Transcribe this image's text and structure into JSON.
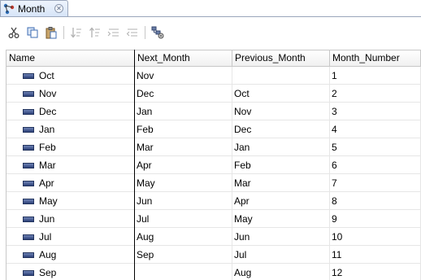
{
  "tab": {
    "title": "Month",
    "icon": "hierarchy-icon",
    "close_icon": "close-icon"
  },
  "toolbar": {
    "buttons": [
      {
        "name": "cut-icon",
        "enabled": true
      },
      {
        "name": "copy-icon",
        "enabled": true
      },
      {
        "name": "paste-icon",
        "enabled": true
      },
      {
        "name": "sort-descending-icon",
        "enabled": false
      },
      {
        "name": "sort-ascending-icon",
        "enabled": false
      },
      {
        "name": "indent-icon",
        "enabled": false
      },
      {
        "name": "outdent-icon",
        "enabled": false
      },
      {
        "name": "hierarchy-settings-icon",
        "enabled": true
      }
    ]
  },
  "table": {
    "columns": [
      "Name",
      "Next_Month",
      "Previous_Month",
      "Month_Number"
    ],
    "rows": [
      {
        "name": "Oct",
        "next": "Nov",
        "prev": "",
        "num": "1"
      },
      {
        "name": "Nov",
        "next": "Dec",
        "prev": "Oct",
        "num": "2"
      },
      {
        "name": "Dec",
        "next": "Jan",
        "prev": "Nov",
        "num": "3"
      },
      {
        "name": "Jan",
        "next": "Feb",
        "prev": "Dec",
        "num": "4"
      },
      {
        "name": "Feb",
        "next": "Mar",
        "prev": "Jan",
        "num": "5"
      },
      {
        "name": "Mar",
        "next": "Apr",
        "prev": "Feb",
        "num": "6"
      },
      {
        "name": "Apr",
        "next": "May",
        "prev": "Mar",
        "num": "7"
      },
      {
        "name": "May",
        "next": "Jun",
        "prev": "Apr",
        "num": "8"
      },
      {
        "name": "Jun",
        "next": "Jul",
        "prev": "May",
        "num": "9"
      },
      {
        "name": "Jul",
        "next": "Aug",
        "prev": "Jun",
        "num": "10"
      },
      {
        "name": "Aug",
        "next": "Sep",
        "prev": "Jul",
        "num": "11"
      },
      {
        "name": "Sep",
        "next": "",
        "prev": "Aug",
        "num": "12"
      }
    ]
  },
  "colors": {
    "row_icon": "#2d4178",
    "tab_background": "#d6e4f7",
    "grid_line": "#c8c8c8"
  }
}
